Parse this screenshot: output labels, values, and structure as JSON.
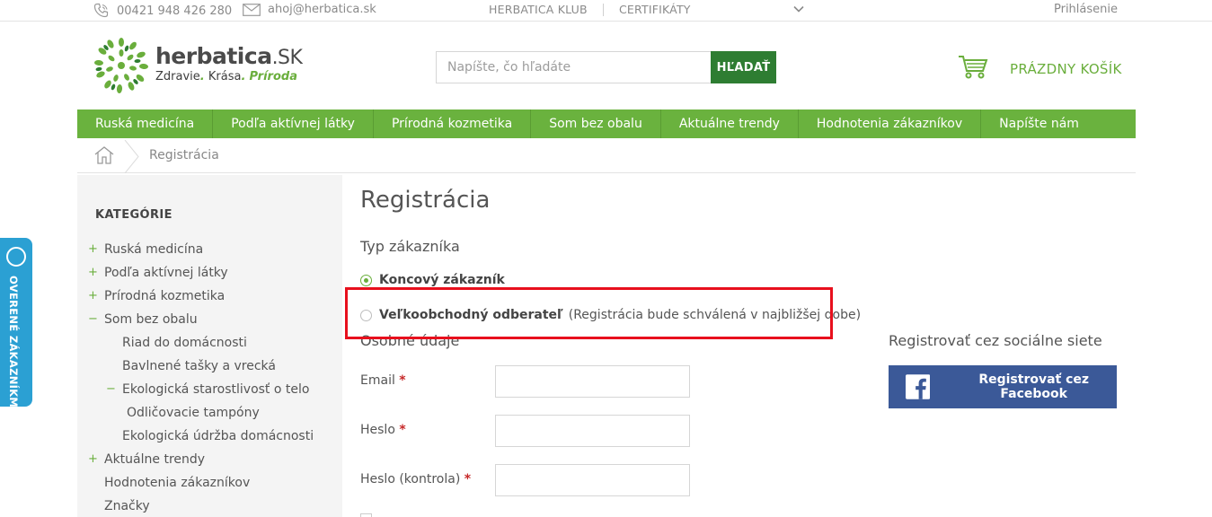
{
  "topbar": {
    "phone": "00421 948 426 280",
    "email": "ahoj@herbatica.sk",
    "club": "HERBATICA KLUB",
    "certificates": "CERTIFIKÁTY",
    "login": "Prihlásenie"
  },
  "logo": {
    "name": "herbatica",
    "tld": ".SK",
    "tag_part1": "Zdravie",
    "tag_part2": "Krása",
    "tag_part3": "Príroda"
  },
  "search": {
    "placeholder": "Napíšte, čo hľadáte",
    "button": "HĽADAŤ"
  },
  "cart": {
    "label": "PRÁZDNY KOŠÍK"
  },
  "nav": {
    "items": [
      "Ruská medicína",
      "Podľa aktívnej látky",
      "Prírodná kozmetika",
      "Som bez obalu",
      "Aktuálne trendy",
      "Hodnotenia zákazníkov",
      "Napíšte nám"
    ]
  },
  "breadcrumb": {
    "current": "Registrácia"
  },
  "sidebar": {
    "title": "KATEGÓRIE",
    "items": [
      {
        "label": "Ruská medicína",
        "marker": "+"
      },
      {
        "label": "Podľa aktívnej látky",
        "marker": "+"
      },
      {
        "label": "Prírodná kozmetika",
        "marker": "+"
      },
      {
        "label": "Som bez obalu",
        "marker": "−"
      },
      {
        "label": "Riad do domácnosti",
        "marker": ""
      },
      {
        "label": "Bavlnené tašky a vrecká",
        "marker": ""
      },
      {
        "label": "Ekologická starostlivosť o telo",
        "marker": "−"
      },
      {
        "label": "Odličovacie tampóny",
        "marker": ""
      },
      {
        "label": "Ekologická údržba domácnosti",
        "marker": ""
      },
      {
        "label": "Aktuálne trendy",
        "marker": "+"
      },
      {
        "label": "Hodnotenia zákazníkov",
        "marker": ""
      },
      {
        "label": "Značky",
        "marker": ""
      }
    ]
  },
  "main": {
    "title": "Registrácia",
    "customer_type_label": "Typ zákazníka",
    "option_retail": "Koncový zákazník",
    "option_wholesale": "Veľkoobchodný odberateľ",
    "option_wholesale_note": "(Registrácia bude schválená v najbližšej dobe)",
    "personal_label": "Osobné údaje",
    "fields": {
      "email": "Email",
      "password": "Heslo",
      "password_confirm": "Heslo (kontrola)",
      "required_mark": "*"
    }
  },
  "social": {
    "title": "Registrovať cez sociálne siete",
    "facebook_button": "Registrovať cez Facebook"
  },
  "side_tab": {
    "label": "OVERENÉ ZÁKAZNÍKMI"
  },
  "colors": {
    "brand_green": "#6ab23e",
    "search_button": "#2e7d32",
    "facebook": "#3b5998",
    "highlight": "#e8101d",
    "side_tab": "#2ba0d3"
  }
}
